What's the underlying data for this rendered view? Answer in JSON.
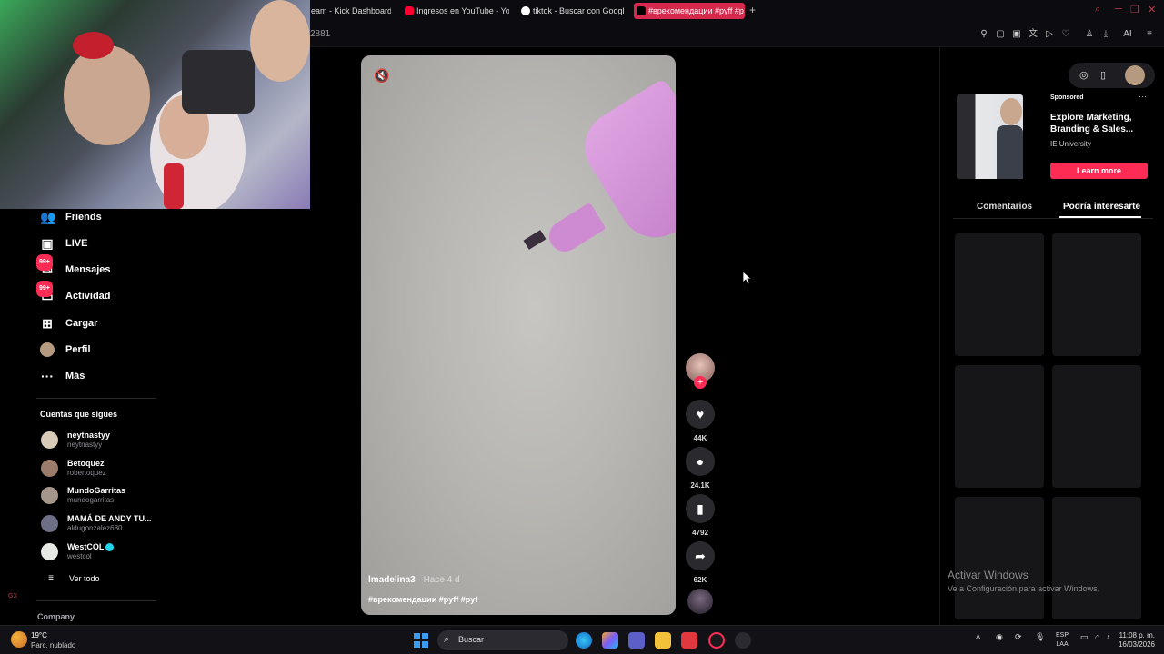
{
  "browser": {
    "tabs": [
      {
        "label": "eam - Kick Dashboard",
        "favicon_color": "#1b1b1b"
      },
      {
        "label": "Ingresos en YouTube - Yo",
        "favicon_color": "#ff0033"
      },
      {
        "label": "tiktok - Buscar con Googl",
        "favicon_color": "#ffffff"
      },
      {
        "label": "#врекомендации #pyff #p",
        "favicon_color": "#000000"
      }
    ],
    "new_tab": "+",
    "url_fragment": "2881",
    "window_controls": [
      "search-icon",
      "minimize-icon",
      "maximize-icon",
      "close-icon"
    ],
    "toolbar_ai_label": "AI"
  },
  "sidebar": {
    "nav": [
      {
        "label": "Friends",
        "icon": "friends-icon",
        "badge": ""
      },
      {
        "label": "LIVE",
        "icon": "live-icon",
        "badge": ""
      },
      {
        "label": "Mensajes",
        "icon": "messages-icon",
        "badge": "99+"
      },
      {
        "label": "Actividad",
        "icon": "activity-icon",
        "badge": "99+"
      },
      {
        "label": "Cargar",
        "icon": "upload-icon",
        "badge": ""
      },
      {
        "label": "Perfil",
        "icon": "profile-avatar",
        "badge": ""
      },
      {
        "label": "Más",
        "icon": "more-icon",
        "badge": ""
      }
    ],
    "following_title": "Cuentas que sigues",
    "following": [
      {
        "name": "neytnastyy",
        "username": "neytnastyy",
        "verified": false
      },
      {
        "name": "Betoquez",
        "username": "robertoquez",
        "verified": false
      },
      {
        "name": "MundoGarritas",
        "username": "mundogarritas",
        "verified": false
      },
      {
        "name": "MAMÁ DE ANDY TU...",
        "username": "aldugonzalez680",
        "verified": false
      },
      {
        "name": "WestCOL",
        "username": "westcol",
        "verified": true
      }
    ],
    "see_all": "Ver todo",
    "company": "Company",
    "gx_mark": "GX"
  },
  "video": {
    "author": "lmadelina3",
    "time": " · Hace 4 d",
    "tags": "#врекомендации #pyff #pyf"
  },
  "actions": {
    "likes": "44K",
    "comments": "24.1K",
    "saves": "4792",
    "shares": "62K"
  },
  "right_panel": {
    "sponsored": "Sponsored",
    "more": "···",
    "ad_title": "Explore Marketing, Branding & Sales...",
    "ad_brand": "IE University",
    "ad_button": "Learn more",
    "tabs": [
      "Comentarios",
      "Podría interesarte"
    ],
    "watermark_title": "Activar Windows",
    "watermark_sub": "Ve a Configuración para activar Windows."
  },
  "taskbar": {
    "temperature": "19°C",
    "weather": "Parc. nublado",
    "search_label": "Buscar",
    "lang_top": "ESP",
    "lang_bottom": "LAA",
    "time": "11:08 p. m.",
    "date": "16/03/2026"
  },
  "colors": {
    "accent": "#fe2c55",
    "active_tab": "#d6294e",
    "background": "#000000"
  }
}
